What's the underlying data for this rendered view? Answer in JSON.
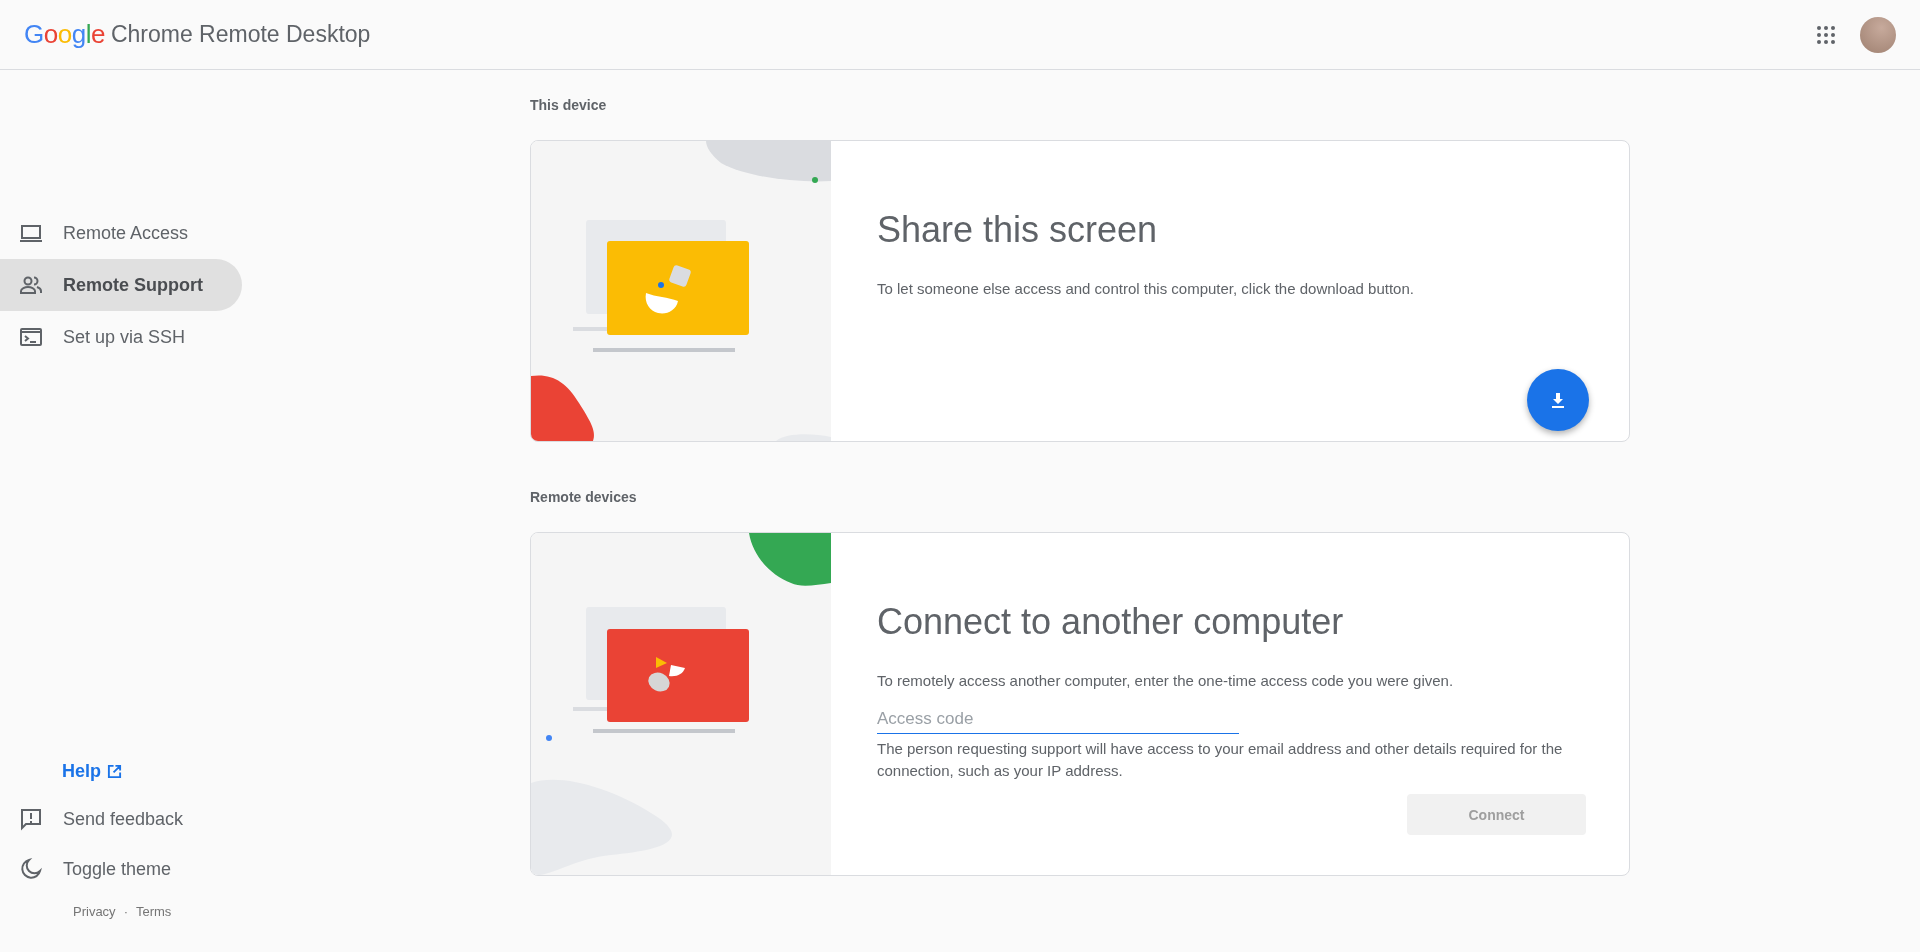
{
  "header": {
    "logo": "Google",
    "title": "Chrome Remote Desktop"
  },
  "sidebar": {
    "items": [
      {
        "kind": "laptop",
        "label": "Remote Access",
        "selected": false
      },
      {
        "kind": "people",
        "label": "Remote Support",
        "selected": true
      },
      {
        "kind": "terminal",
        "label": "Set up via SSH",
        "selected": false
      }
    ],
    "help": "Help",
    "footer_items": [
      {
        "kind": "feedback",
        "label": "Send feedback"
      },
      {
        "kind": "theme",
        "label": "Toggle theme"
      }
    ],
    "links": [
      "Privacy",
      "Terms"
    ],
    "separator": "·"
  },
  "sections": [
    {
      "label": "This device",
      "card": {
        "kind": "share",
        "title": "Share this screen",
        "description": "To let someone else access and control this computer, click the download button."
      }
    },
    {
      "label": "Remote devices",
      "card": {
        "kind": "connect",
        "title": "Connect to another computer",
        "description": "To remotely access another computer, enter the one-time access code you were given.",
        "field": {
          "placeholder": "Access code"
        },
        "note": "The person requesting support will have access to your email address and other details required for the connection, such as your IP address.",
        "button": {
          "label": "Connect",
          "disabled": true
        }
      }
    }
  ]
}
